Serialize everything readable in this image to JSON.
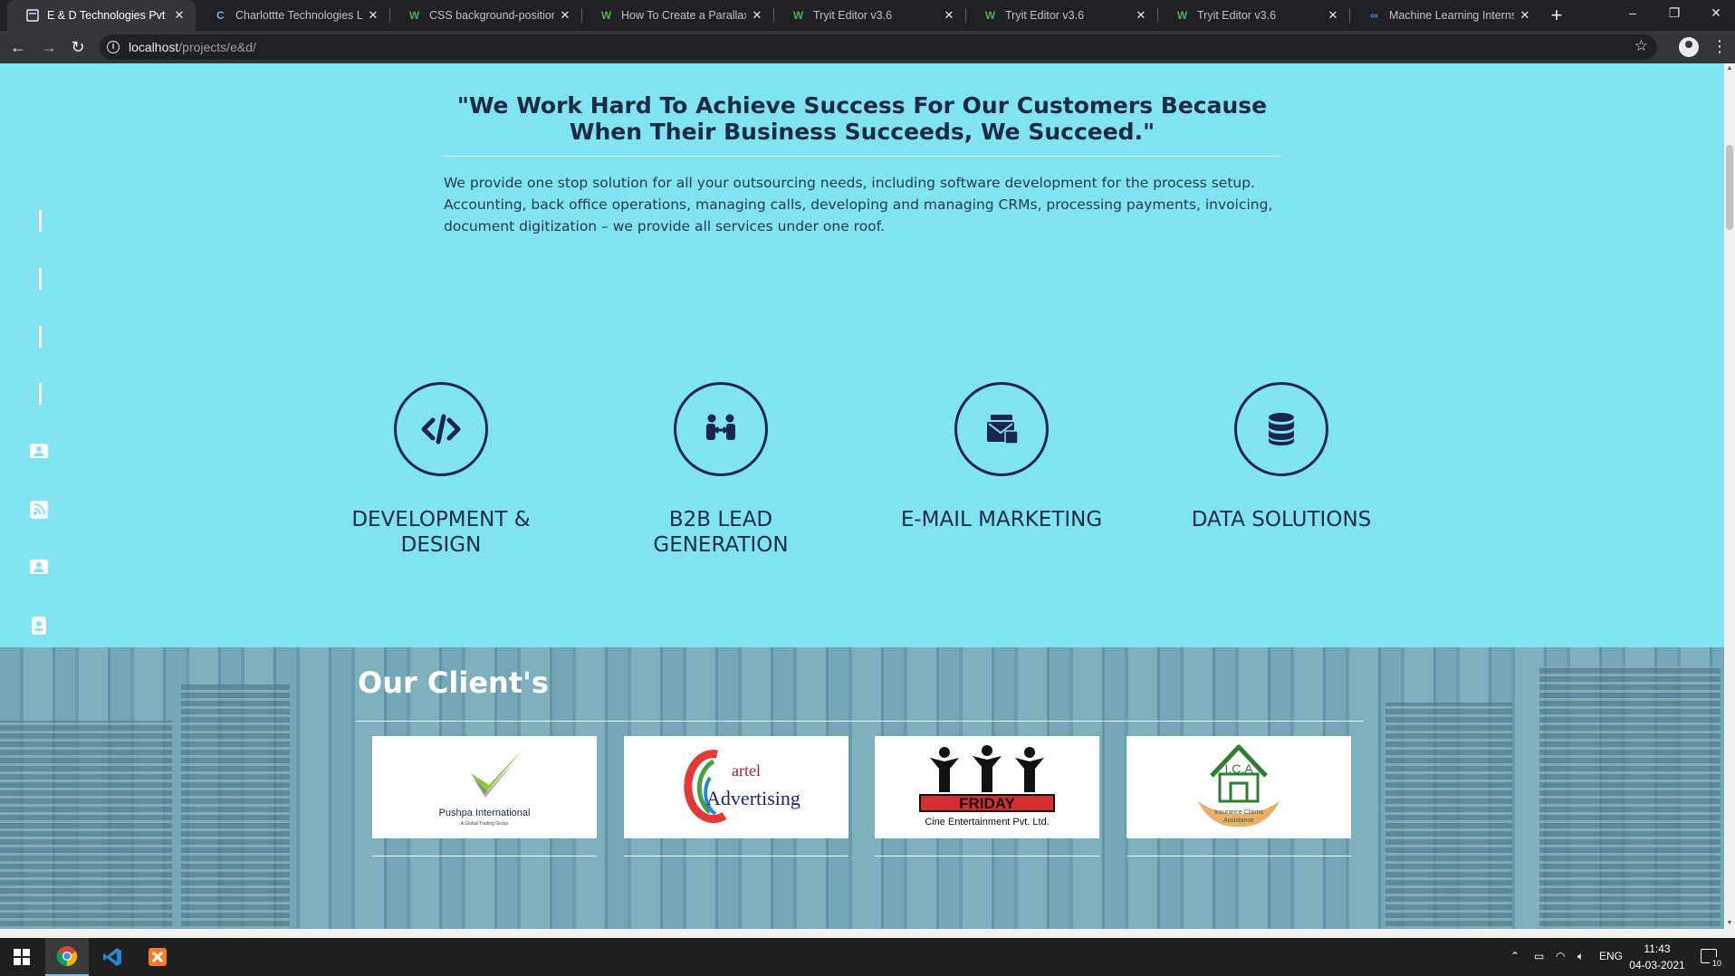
{
  "browser": {
    "tabs": [
      {
        "title": "E & D Technologies Pvt ltd",
        "favicon": "page-icon"
      },
      {
        "title": "Charlottte Technologies LLC",
        "favicon": "c-logo-icon"
      },
      {
        "title": "CSS background-position p",
        "favicon": "w3schools-icon"
      },
      {
        "title": "How To Create a Parallax Sc",
        "favicon": "w3schools-icon"
      },
      {
        "title": "Tryit Editor v3.6",
        "favicon": "w3schools-icon"
      },
      {
        "title": "Tryit Editor v3.6",
        "favicon": "w3schools-icon"
      },
      {
        "title": "Tryit Editor v3.6",
        "favicon": "w3schools-icon"
      },
      {
        "title": "Machine Learning Internship",
        "favicon": "meta-icon"
      }
    ],
    "address": {
      "host": "localhost",
      "path": "/projects/e&d/"
    }
  },
  "about": {
    "quote": "\"We Work Hard To Achieve Success For Our Customers Because When Their Business Succeeds, We Succeed.\"",
    "text": "We provide one stop solution for all your outsourcing needs, including software development for the process setup. Accounting, back office operations, managing calls, developing and managing CRMs, processing payments, invoicing, document digitization – we provide all services under one roof."
  },
  "services": [
    {
      "title": "DEVELOPMENT & DESIGN",
      "icon": "code-icon"
    },
    {
      "title": "B2B LEAD GENERATION",
      "icon": "handshake-icon"
    },
    {
      "title": "E-MAIL MARKETING",
      "icon": "mail-bulk-icon"
    },
    {
      "title": "DATA SOLUTIONS",
      "icon": "database-icon"
    }
  ],
  "clients": {
    "title": "Our Client's",
    "logos": [
      {
        "name": "Pushpa International",
        "tagline": "A Global Trading Group"
      },
      {
        "name": "Cartel Advertising"
      },
      {
        "name": "FRIDAY",
        "tagline": "Cine Entertainment Pvt. Ltd."
      },
      {
        "name": "I.C.A",
        "tagline": "Insurance Claims Assistance"
      }
    ]
  },
  "taskbar": {
    "lang": "ENG",
    "time": "11:43",
    "date": "04-03-2021",
    "notifications": "10"
  },
  "colors": {
    "page_bg": "#7fe3f1",
    "icon_navy": "#1c2550",
    "text_dark": "#1c2b4a"
  }
}
